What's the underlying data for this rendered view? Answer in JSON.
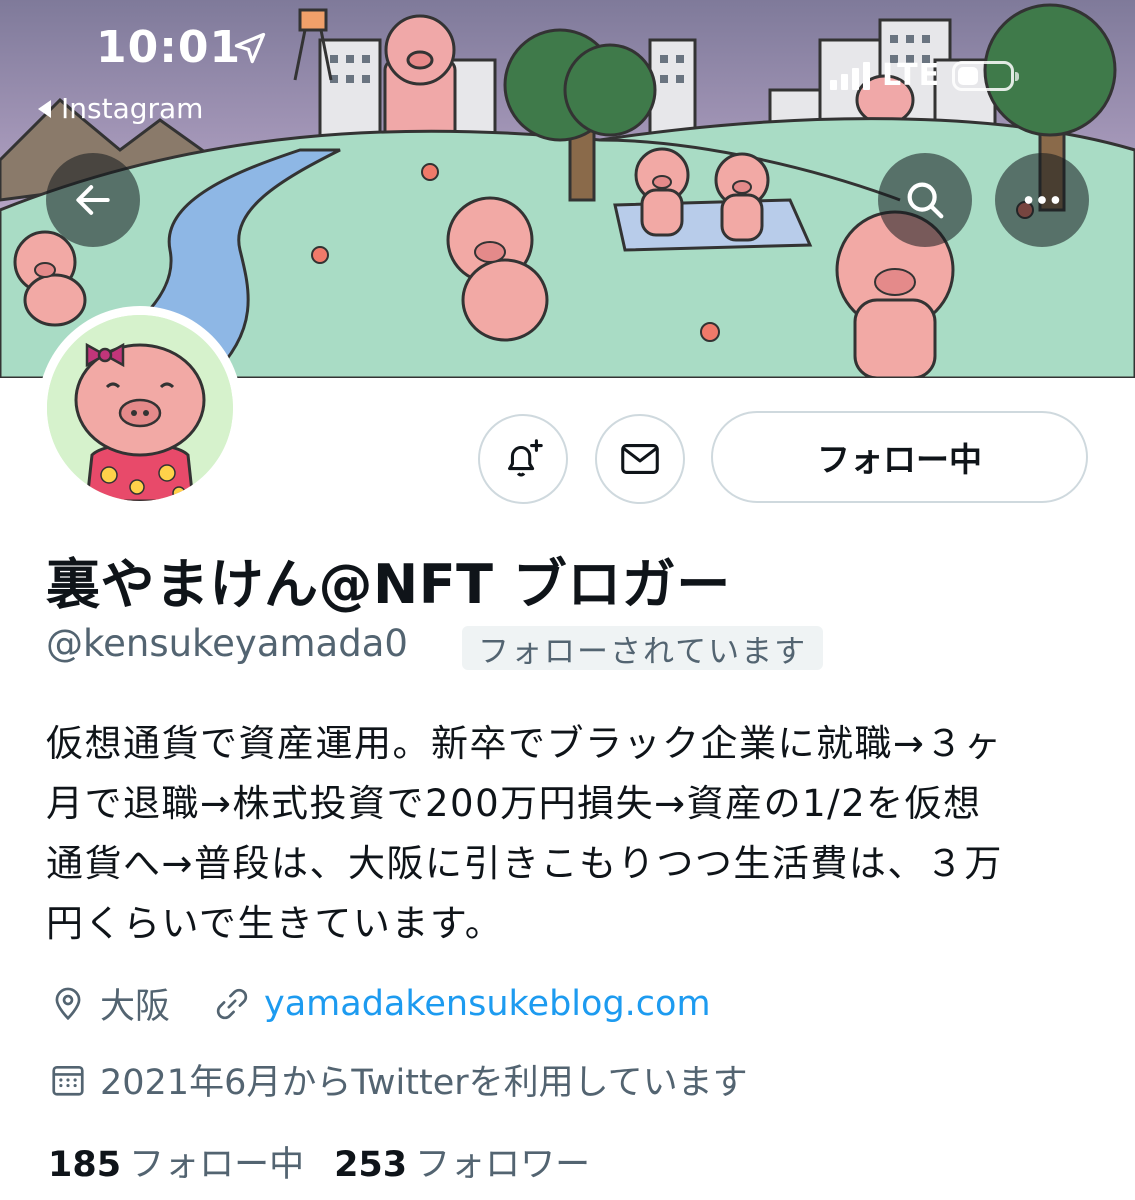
{
  "status_bar": {
    "time": "10:01",
    "back_app": "Instagram",
    "network": "LTE",
    "battery_level": 0.4
  },
  "banner": {
    "description_icon": "pig-park-illustration"
  },
  "header_buttons": {
    "back_icon": "arrow-left-icon",
    "search_icon": "search-icon",
    "more_icon": "more-horizontal-icon"
  },
  "profile": {
    "display_name": "裏やまけん@NFT ブロガー",
    "handle": "@kensukeyamada0",
    "follows_you": "フォローされています",
    "bio_lines": [
      "仮想通貨で資産運用。新卒でブラック企業に就職→３ヶ",
      "月で退職→株式投資で200万円損失→資産の1/2を仮想",
      "通貨へ→普段は、大阪に引きこもりつつ生活費は、３万",
      "円くらいで生きています。"
    ],
    "location": "大阪",
    "website": "yamadakensukeblog.com",
    "joined": "2021年6月からTwitterを利用しています",
    "following_count": "185",
    "following_label": "フォロー中",
    "followers_count": "253",
    "followers_label": "フォロワー"
  },
  "actions": {
    "notify_icon": "bell-plus-icon",
    "message_icon": "mail-icon",
    "follow_label": "フォロー中"
  },
  "colors": {
    "link": "#1d9bf0",
    "secondary_text": "#536471",
    "sky": "#b8a6c4",
    "grass": "#a8dcc4"
  }
}
